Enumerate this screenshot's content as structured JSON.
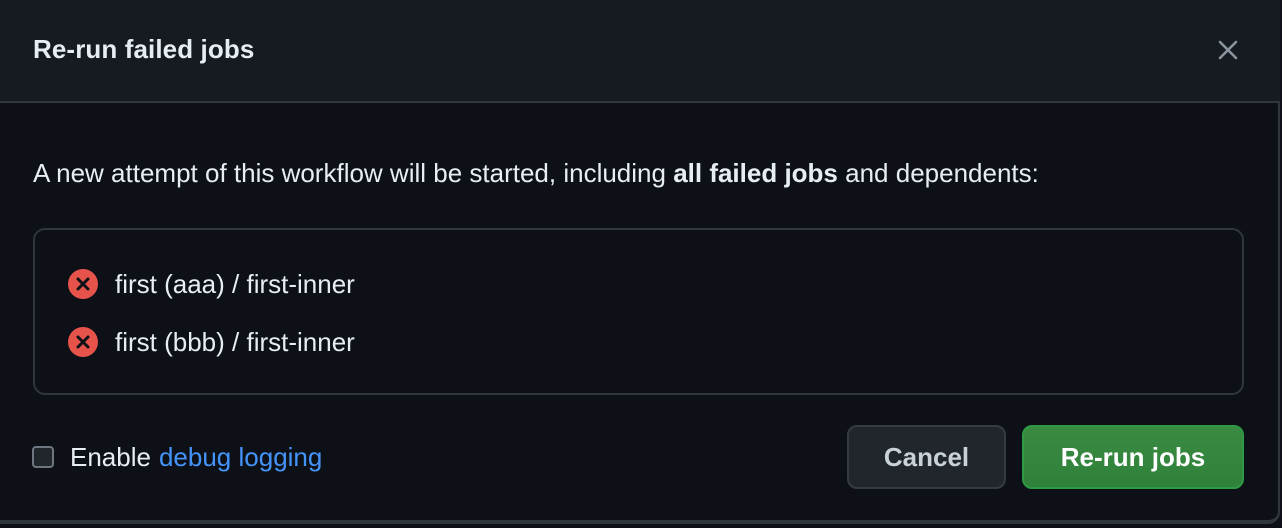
{
  "dialog": {
    "title": "Re-run failed jobs",
    "close_icon": "close-icon",
    "description": {
      "prefix": "A new attempt of this workflow will be started, including ",
      "bold": "all failed jobs",
      "suffix": " and dependents:"
    },
    "jobs": [
      {
        "label": "first (aaa) / first-inner",
        "status_icon": "x-circle-fill-icon",
        "status": "failed"
      },
      {
        "label": "first (bbb) / first-inner",
        "status_icon": "x-circle-fill-icon",
        "status": "failed"
      }
    ],
    "debug": {
      "checked": false,
      "prefix": "Enable",
      "link": "debug logging"
    },
    "buttons": {
      "cancel": "Cancel",
      "rerun": "Re-run jobs"
    }
  },
  "colors": {
    "background": "#0d1117",
    "header": "#161b22",
    "border": "#30363d",
    "text": "#e6edf3",
    "link": "#4493f8",
    "fail": "#e5534b",
    "primary": "#2f8139"
  }
}
